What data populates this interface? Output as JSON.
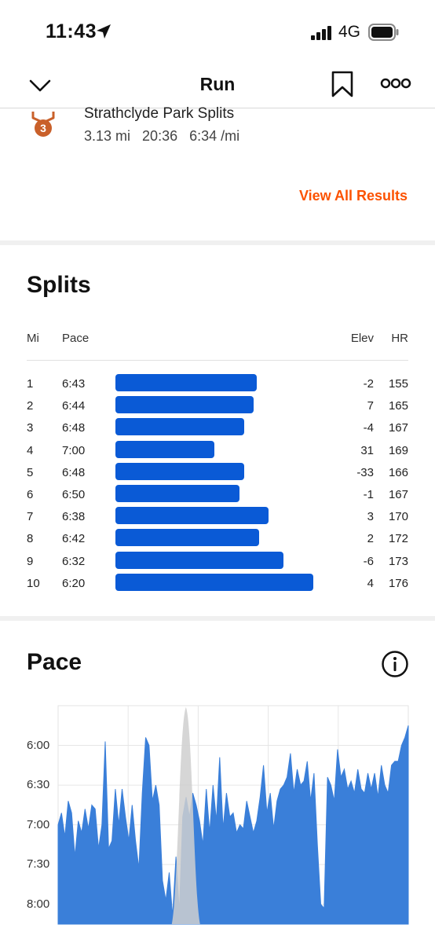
{
  "status": {
    "time": "11:43",
    "network": "4G"
  },
  "nav": {
    "title": "Run"
  },
  "segment": {
    "name": "Strathclyde Park Splits",
    "distance": "3.13 mi",
    "time": "20:36",
    "pace": "6:34 /mi",
    "medal_rank": "3",
    "medal_color": "#c9602a"
  },
  "view_all_label": "View All Results",
  "accent_color": "#fc5200",
  "splits": {
    "title": "Splits",
    "headers": {
      "mi": "Mi",
      "pace": "Pace",
      "elev": "Elev",
      "hr": "HR"
    },
    "bar_color": "#0a5ad6",
    "rows": [
      {
        "mi": "1",
        "pace": "6:43",
        "elev": "-2",
        "hr": "155"
      },
      {
        "mi": "2",
        "pace": "6:44",
        "elev": "7",
        "hr": "165"
      },
      {
        "mi": "3",
        "pace": "6:48",
        "elev": "-4",
        "hr": "167"
      },
      {
        "mi": "4",
        "pace": "7:00",
        "elev": "31",
        "hr": "169"
      },
      {
        "mi": "5",
        "pace": "6:48",
        "elev": "-33",
        "hr": "166"
      },
      {
        "mi": "6",
        "pace": "6:50",
        "elev": "-1",
        "hr": "167"
      },
      {
        "mi": "7",
        "pace": "6:38",
        "elev": "3",
        "hr": "170"
      },
      {
        "mi": "8",
        "pace": "6:42",
        "elev": "2",
        "hr": "172"
      },
      {
        "mi": "9",
        "pace": "6:32",
        "elev": "-6",
        "hr": "173"
      },
      {
        "mi": "10",
        "pace": "6:20",
        "elev": "4",
        "hr": "176"
      }
    ]
  },
  "pace_section": {
    "title": "Pace"
  },
  "chart_data": {
    "type": "area",
    "title": "Pace",
    "y_axis": {
      "ticks": [
        "6:00",
        "6:30",
        "7:00",
        "7:30",
        "8:00"
      ],
      "inverted": true,
      "ylim_min_per_mi": [
        5.5,
        8.25
      ]
    },
    "grid": true,
    "series_color": "#3a7fd9",
    "overlay_color": "#cfcfcf",
    "values_min_per_mi": [
      7.0,
      6.85,
      7.15,
      6.7,
      6.85,
      7.4,
      6.95,
      7.1,
      6.8,
      7.05,
      6.75,
      6.8,
      7.3,
      7.0,
      5.95,
      7.3,
      7.2,
      6.55,
      7.0,
      6.55,
      6.9,
      7.2,
      6.75,
      7.2,
      7.55,
      6.6,
      5.9,
      6.0,
      6.7,
      6.5,
      6.75,
      7.7,
      7.95,
      7.6,
      8.15,
      7.4,
      8.1,
      6.9,
      6.65,
      6.9,
      6.6,
      6.75,
      6.95,
      7.25,
      6.55,
      7.1,
      6.5,
      6.95,
      6.15,
      7.05,
      6.6,
      6.9,
      6.85,
      7.1,
      7.0,
      7.05,
      6.7,
      6.9,
      7.1,
      6.95,
      6.65,
      6.25,
      6.85,
      6.6,
      7.05,
      6.7,
      6.55,
      6.5,
      6.4,
      6.1,
      6.6,
      6.3,
      6.5,
      6.45,
      6.2,
      6.7,
      6.35,
      7.25,
      8.0,
      8.05,
      6.4,
      6.5,
      6.7,
      6.05,
      6.4,
      6.3,
      6.55,
      6.45,
      6.6,
      6.3,
      6.55,
      6.6,
      6.35,
      6.55,
      6.35,
      6.65,
      6.25,
      6.5,
      6.6,
      6.25,
      6.2,
      6.2,
      6.0,
      5.9,
      5.75
    ]
  }
}
